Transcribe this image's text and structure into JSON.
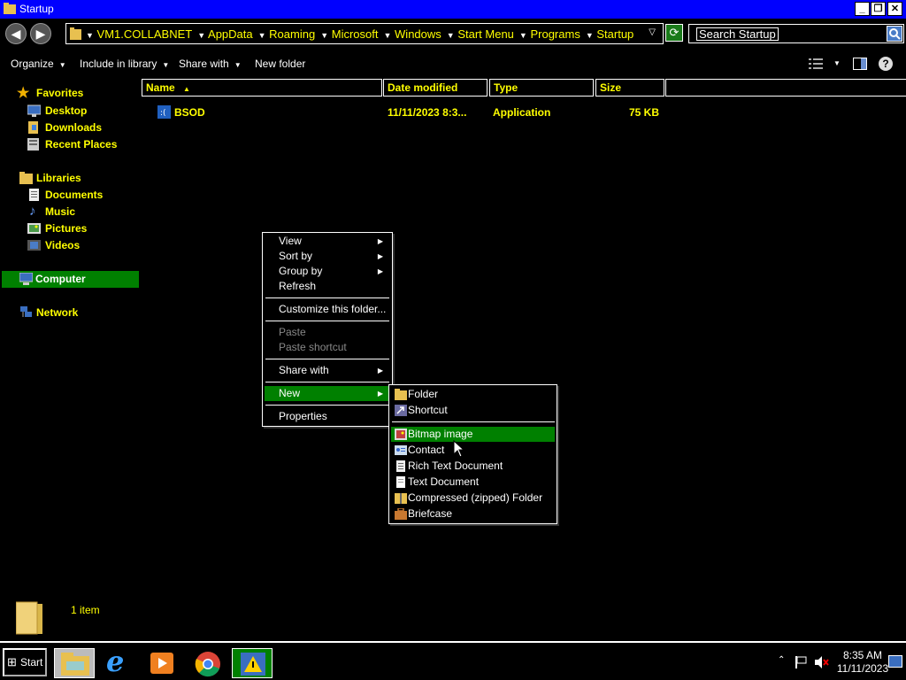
{
  "window": {
    "title": "Startup"
  },
  "address": {
    "crumbs": [
      "VM1.COLLABNET",
      "AppData",
      "Roaming",
      "Microsoft",
      "Windows",
      "Start Menu",
      "Programs",
      "Startup"
    ]
  },
  "search": {
    "placeholder": "Search Startup"
  },
  "toolbar": {
    "organize": "Organize",
    "include_in_library": "Include in library",
    "share_with": "Share with",
    "new_folder": "New folder"
  },
  "columns": {
    "name": "Name",
    "date_modified": "Date modified",
    "type": "Type",
    "size": "Size"
  },
  "nav": {
    "favorites": "Favorites",
    "desktop": "Desktop",
    "downloads": "Downloads",
    "recent_places": "Recent Places",
    "libraries": "Libraries",
    "documents": "Documents",
    "music": "Music",
    "pictures": "Pictures",
    "videos": "Videos",
    "computer": "Computer",
    "network": "Network"
  },
  "files": [
    {
      "name": "BSOD",
      "date_modified": "11/11/2023 8:3...",
      "type": "Application",
      "size": "75 KB"
    }
  ],
  "context_menu": {
    "view": "View",
    "sort_by": "Sort by",
    "group_by": "Group by",
    "refresh": "Refresh",
    "customize": "Customize this folder...",
    "paste": "Paste",
    "paste_shortcut": "Paste shortcut",
    "share_with": "Share with",
    "new": "New",
    "properties": "Properties"
  },
  "new_submenu": {
    "folder": "Folder",
    "shortcut": "Shortcut",
    "bitmap": "Bitmap image",
    "contact": "Contact",
    "rtf": "Rich Text Document",
    "text": "Text Document",
    "zip": "Compressed (zipped) Folder",
    "briefcase": "Briefcase"
  },
  "status": {
    "item_count": "1 item"
  },
  "taskbar": {
    "start": "Start",
    "time": "8:35 AM",
    "date": "11/11/2023"
  },
  "colors": {
    "highlight": "#008000",
    "text_yellow": "#ffff00",
    "title_blue": "#0000ff"
  }
}
